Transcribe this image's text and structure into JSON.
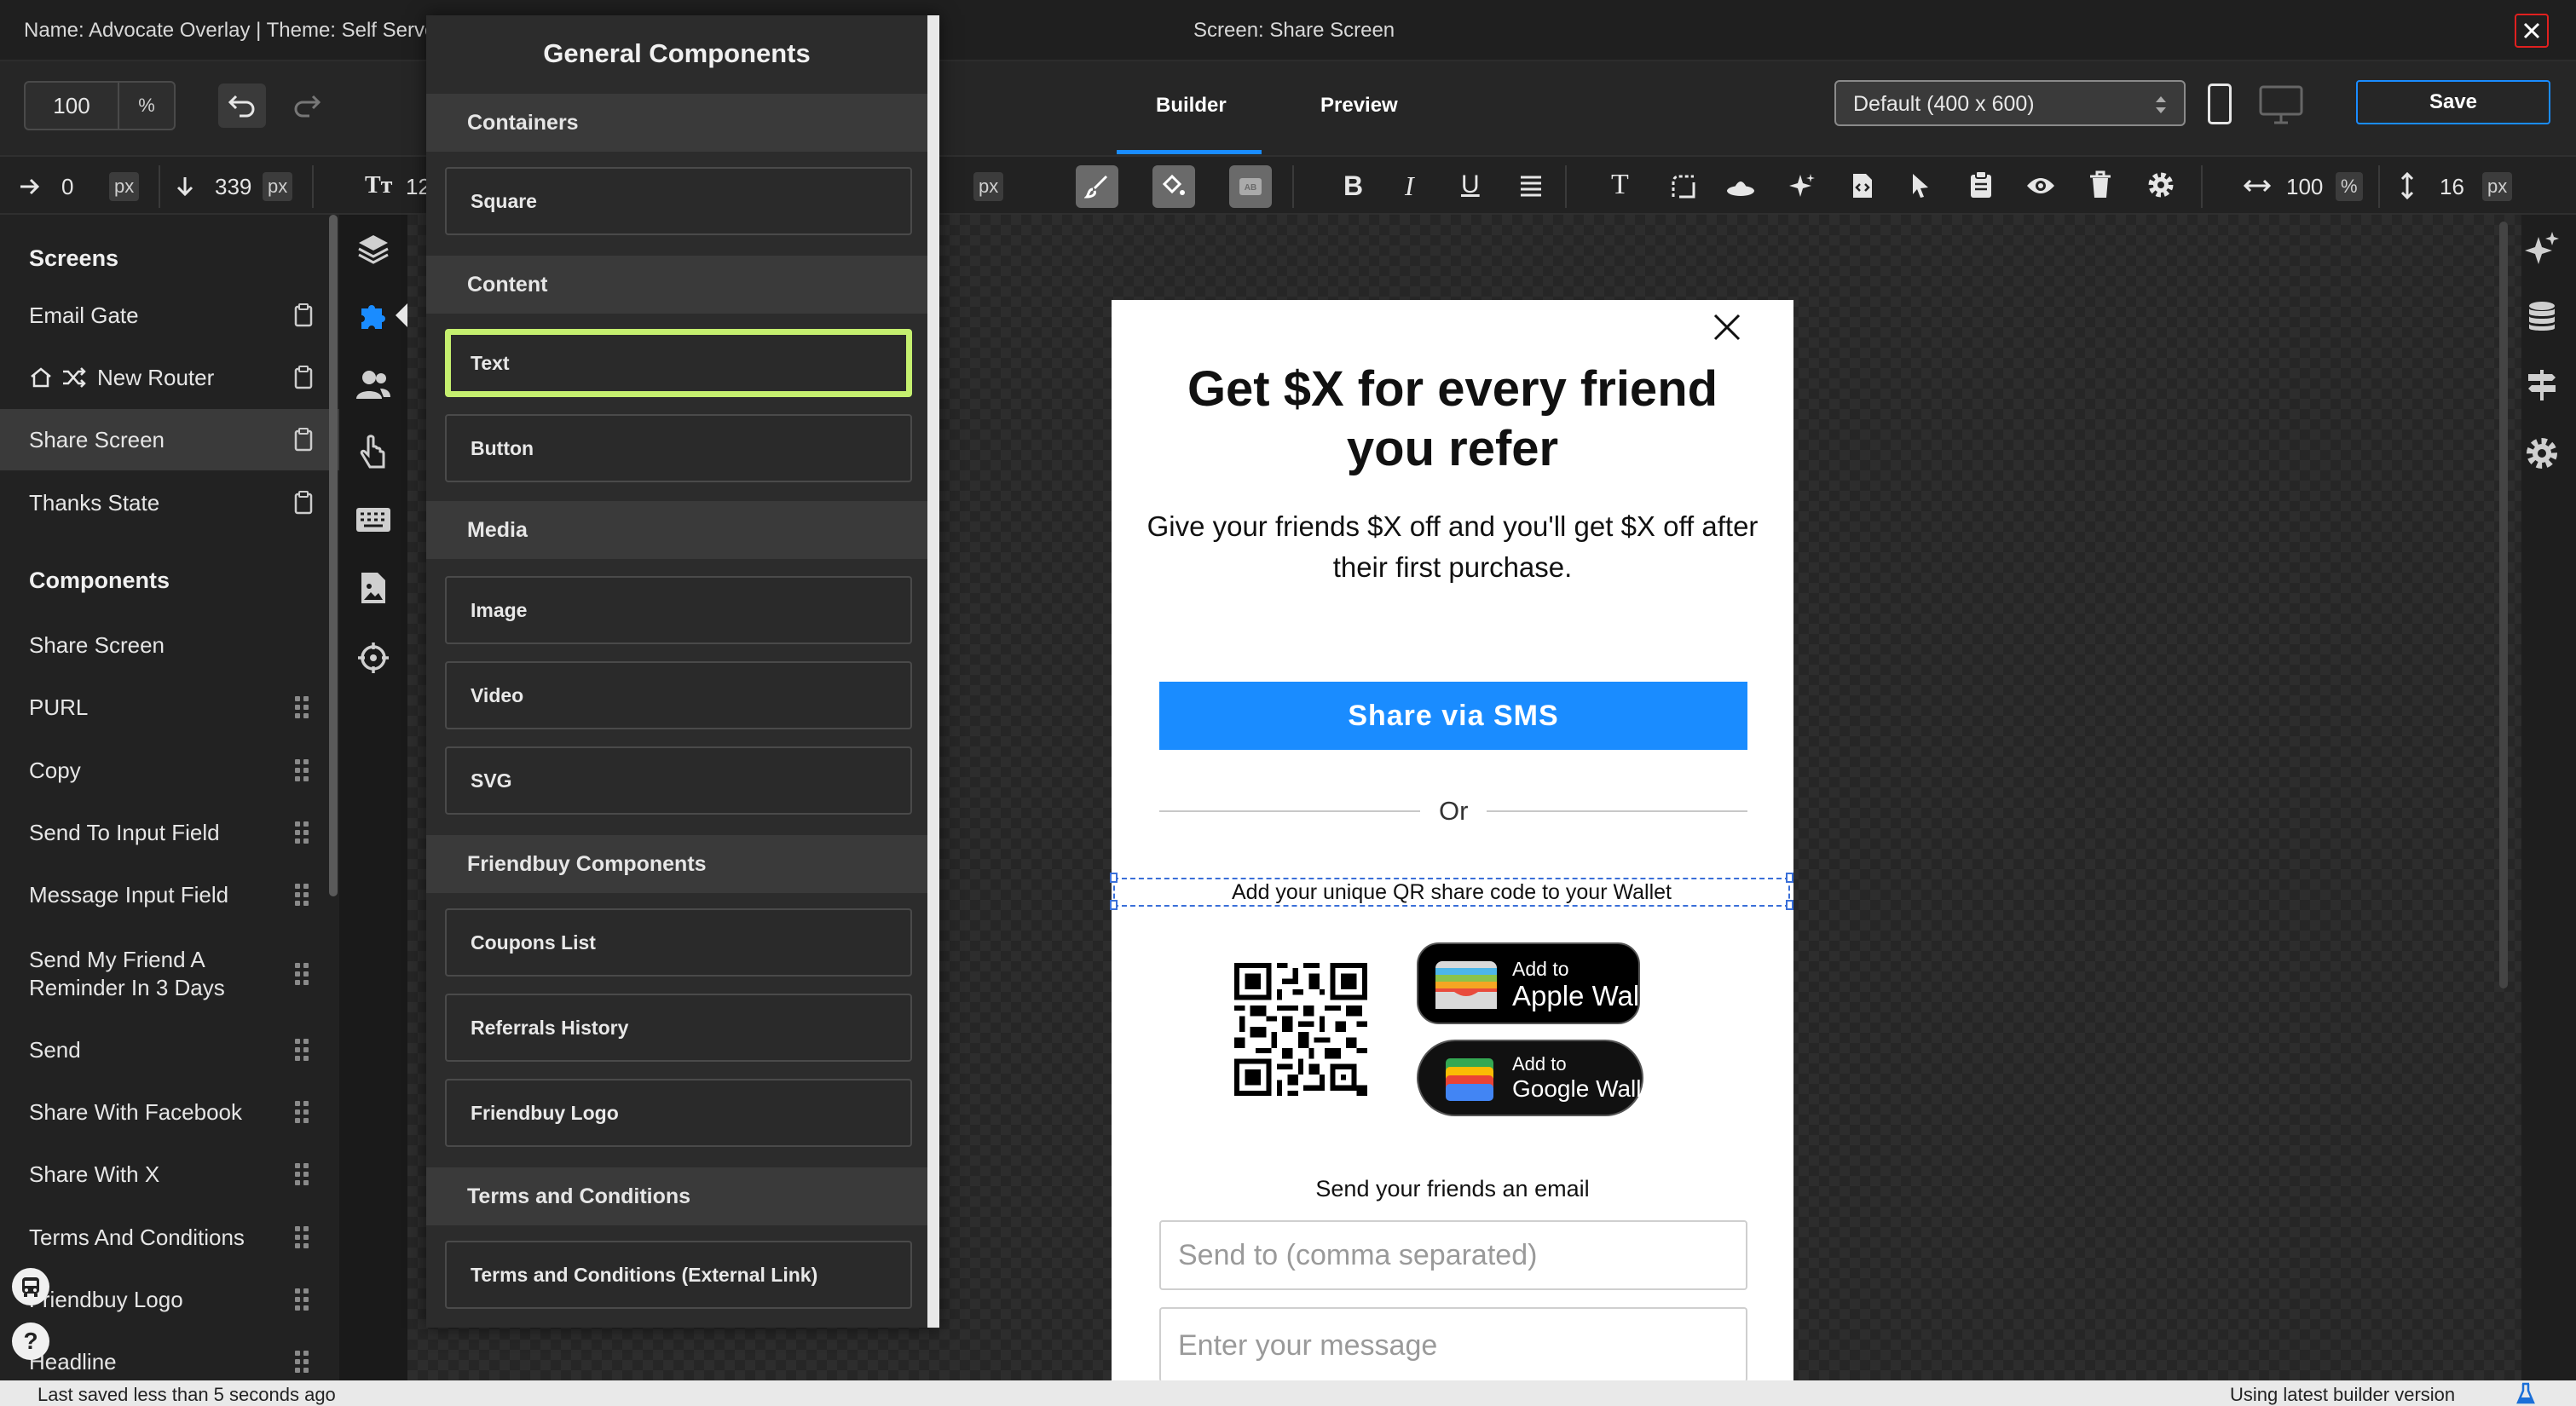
{
  "titlebar": {
    "left_text": "Name: Advocate Overlay | Theme: Self Serve",
    "center_text": "Screen: Share Screen"
  },
  "toolbar": {
    "zoom_value": "100",
    "zoom_unit": "%",
    "tabs": [
      "Builder",
      "Preview"
    ],
    "active_tab": "Builder",
    "device_select": "Default (400 x 600)",
    "save_label": "Save"
  },
  "propbar": {
    "x_value": "0",
    "x_unit": "px",
    "y_value": "339",
    "y_unit": "px",
    "font_size_value": "12",
    "hidden_unit": "px",
    "width_value": "100",
    "width_unit": "%",
    "height_value": "16",
    "height_unit": "px"
  },
  "sidebar": {
    "screens_title": "Screens",
    "screens": [
      {
        "label": "Email Gate",
        "selected": false
      },
      {
        "label": "New Router",
        "selected": false
      },
      {
        "label": "Share Screen",
        "selected": true
      },
      {
        "label": "Thanks State",
        "selected": false
      }
    ],
    "components_title": "Components",
    "components": [
      "Share Screen",
      "PURL",
      "Copy",
      "Send To Input Field",
      "Message Input Field",
      "Send My Friend A Reminder In 3 Days",
      "Send",
      "Share With Facebook",
      "Share With X",
      "Terms And Conditions",
      "Friendbuy Logo",
      "Headline"
    ]
  },
  "panel": {
    "title": "General Components",
    "sections": [
      {
        "title": "Containers",
        "items": [
          "Square"
        ]
      },
      {
        "title": "Content",
        "items": [
          "Text",
          "Button"
        ]
      },
      {
        "title": "Media",
        "items": [
          "Image",
          "Video",
          "SVG"
        ]
      },
      {
        "title": "Friendbuy Components",
        "items": [
          "Coupons List",
          "Referrals History",
          "Friendbuy Logo"
        ]
      },
      {
        "title": "Terms and Conditions",
        "items": [
          "Terms and Conditions (External Link)"
        ]
      }
    ],
    "selected_item": "Text"
  },
  "preview": {
    "headline": "Get $X for every friend you refer",
    "subtext": "Give your friends $X off and you'll get $X off after their first purchase.",
    "sms_button": "Share via SMS",
    "divider_text": "Or",
    "wallet_caption": "Add your unique QR share code to your Wallet",
    "apple_small": "Add to",
    "apple_big": "Apple Wallet",
    "google_small": "Add to",
    "google_big": "Google Wallet",
    "email_caption": "Send your friends an email",
    "send_to_placeholder": "Send to (comma separated)",
    "message_placeholder": "Enter your message"
  },
  "status": {
    "left": "Last saved less than 5 seconds ago",
    "right": "Using latest builder version"
  },
  "colors": {
    "accent": "#1a8cff",
    "selection": "#c5ef6f",
    "sms_button": "#1a8cff",
    "close_red": "#e0201f"
  }
}
